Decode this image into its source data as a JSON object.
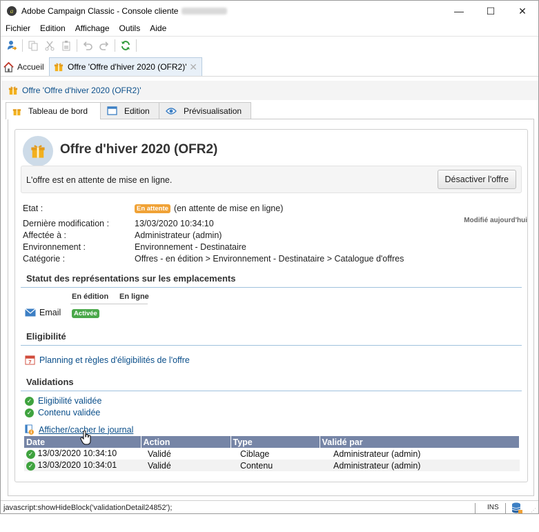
{
  "window": {
    "title": "Adobe Campaign Classic - Console cliente",
    "title_redacted": "(admin@FR)",
    "controls": {
      "minimize": "—",
      "maximize": "☐",
      "close": "✕"
    }
  },
  "menu": [
    "Fichier",
    "Edition",
    "Affichage",
    "Outils",
    "Aide"
  ],
  "tabs": {
    "home_label": "Accueil",
    "offer_label": "Offre 'Offre d'hiver 2020 (OFR2)'",
    "close_glyph": "✕"
  },
  "breadcrumb": "Offre 'Offre d'hiver 2020 (OFR2)'",
  "inner_tabs": [
    "Tableau de bord",
    "Edition",
    "Prévisualisation"
  ],
  "offer": {
    "title": "Offre d'hiver 2020 (OFR2)",
    "status_message": "L'offre est en attente de mise en ligne.",
    "deactivate_label": "Désactiver l'offre",
    "modified_note": "Modifié aujourd'hui"
  },
  "properties": [
    {
      "label": "Etat :",
      "badge": "En attente",
      "value": "(en attente de mise en ligne)"
    },
    {
      "label": "Dernière modification :",
      "value": "13/03/2020 10:34:10"
    },
    {
      "label": "Affectée à :",
      "value": "Administrateur (admin)"
    },
    {
      "label": "Environnement :",
      "value": "Environnement - Destinataire"
    },
    {
      "label": "Catégorie :",
      "value": "Offres - en édition > Environnement - Destinataire > Catalogue d'offres"
    }
  ],
  "representations": {
    "title": "Statut des représentations sur les emplacements",
    "col_editing": "En édition",
    "col_online": "En ligne",
    "channel": "Email",
    "status_badge": "Activée"
  },
  "eligibility": {
    "title": "Eligibilité",
    "link": "Planning et règles d'éligibilités de l'offre",
    "calendar_day": "7"
  },
  "validations": {
    "title": "Validations",
    "items": [
      "Eligibilité validée",
      "Contenu validée"
    ],
    "journal_link": "Afficher/cacher le journal",
    "check_glyph": "✓",
    "table": {
      "headers": [
        "Date",
        "Action",
        "Type",
        "Validé par"
      ],
      "rows": [
        [
          "13/03/2020 10:34:10",
          "Validé",
          "Ciblage",
          "Administrateur (admin)"
        ],
        [
          "13/03/2020 10:34:01",
          "Validé",
          "Contenu",
          "Administrateur (admin)"
        ]
      ]
    }
  },
  "statusbar": {
    "url": "javascript:showHideBlock('validationDetail24852');",
    "ins": "INS"
  },
  "colors": {
    "accent_blue": "#0b4f8a",
    "badge_waiting": "#f0a236",
    "badge_active": "#4aa84a",
    "table_header": "#7685a6",
    "section_rule": "#9fc1dd"
  }
}
